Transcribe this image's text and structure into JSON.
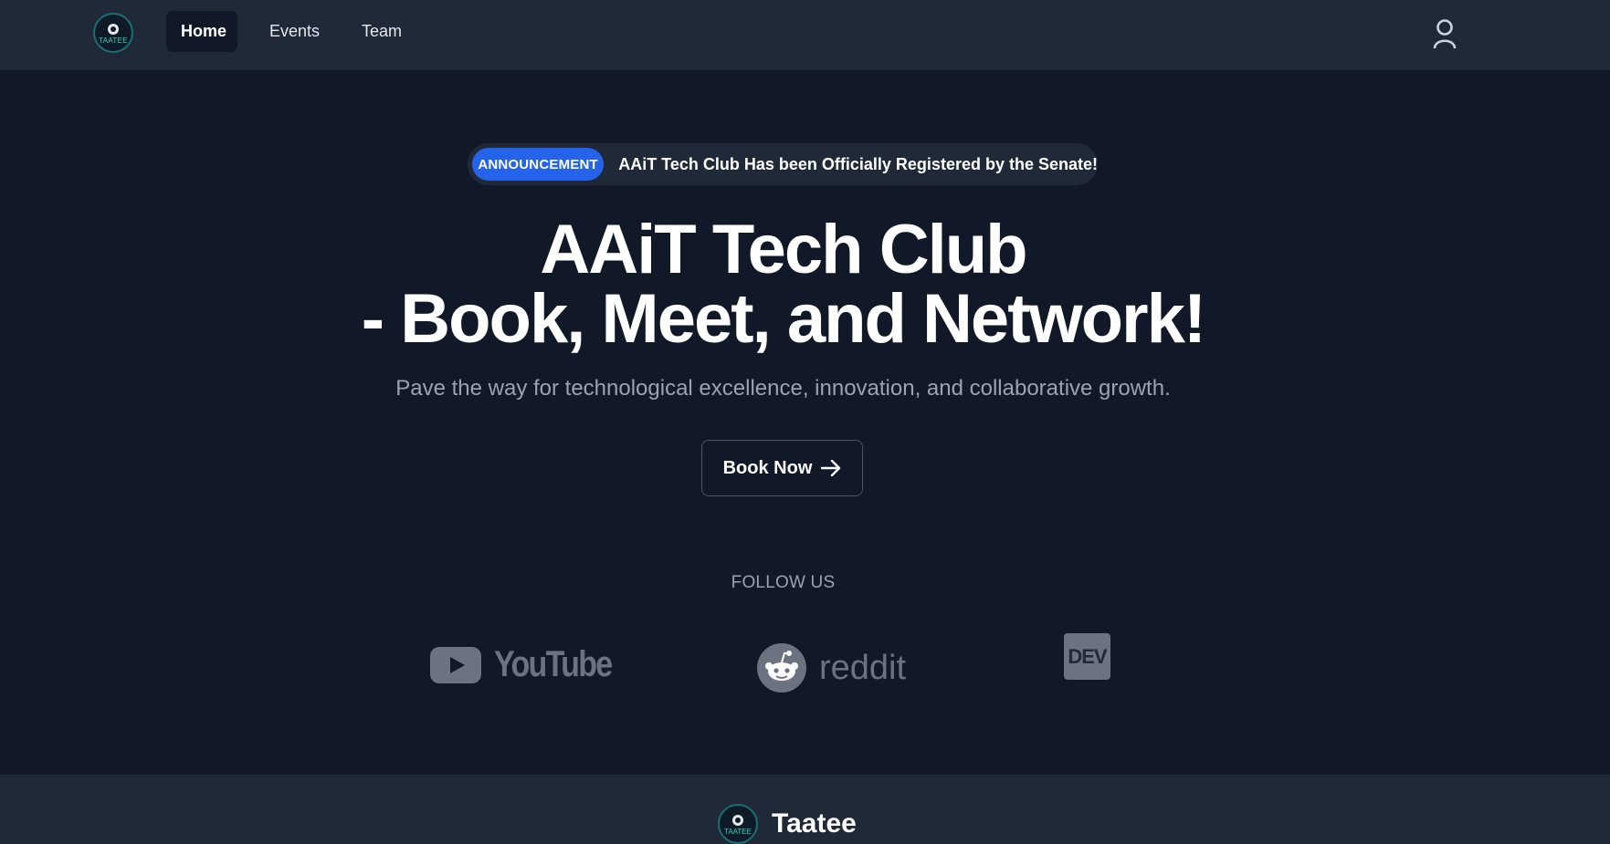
{
  "nav": {
    "logo_text": "TAATEE",
    "items": [
      {
        "label": "Home",
        "active": true
      },
      {
        "label": "Events",
        "active": false
      },
      {
        "label": "Team",
        "active": false
      }
    ],
    "user_icon": "user-icon"
  },
  "announcement": {
    "badge": "ANNOUNCEMENT",
    "text": "AAiT Tech Club Has been Officially Registered by the Senate!"
  },
  "hero": {
    "title_line1": "AAiT Tech Club",
    "title_line2": "- Book, Meet, and Network!",
    "subtitle": "Pave the way for technological excellence, innovation, and collaborative growth.",
    "cta_label": "Book Now"
  },
  "follow": {
    "heading": "FOLLOW US",
    "youtube": "YouTube",
    "reddit": "reddit",
    "dev": "DEV"
  },
  "footer": {
    "logo_text": "TAATEE",
    "name": "Taatee"
  },
  "colors": {
    "background": "#111827",
    "navbar": "#1f2937",
    "accent": "#2563eb",
    "muted": "#9ca3af",
    "social": "#6b7280"
  }
}
